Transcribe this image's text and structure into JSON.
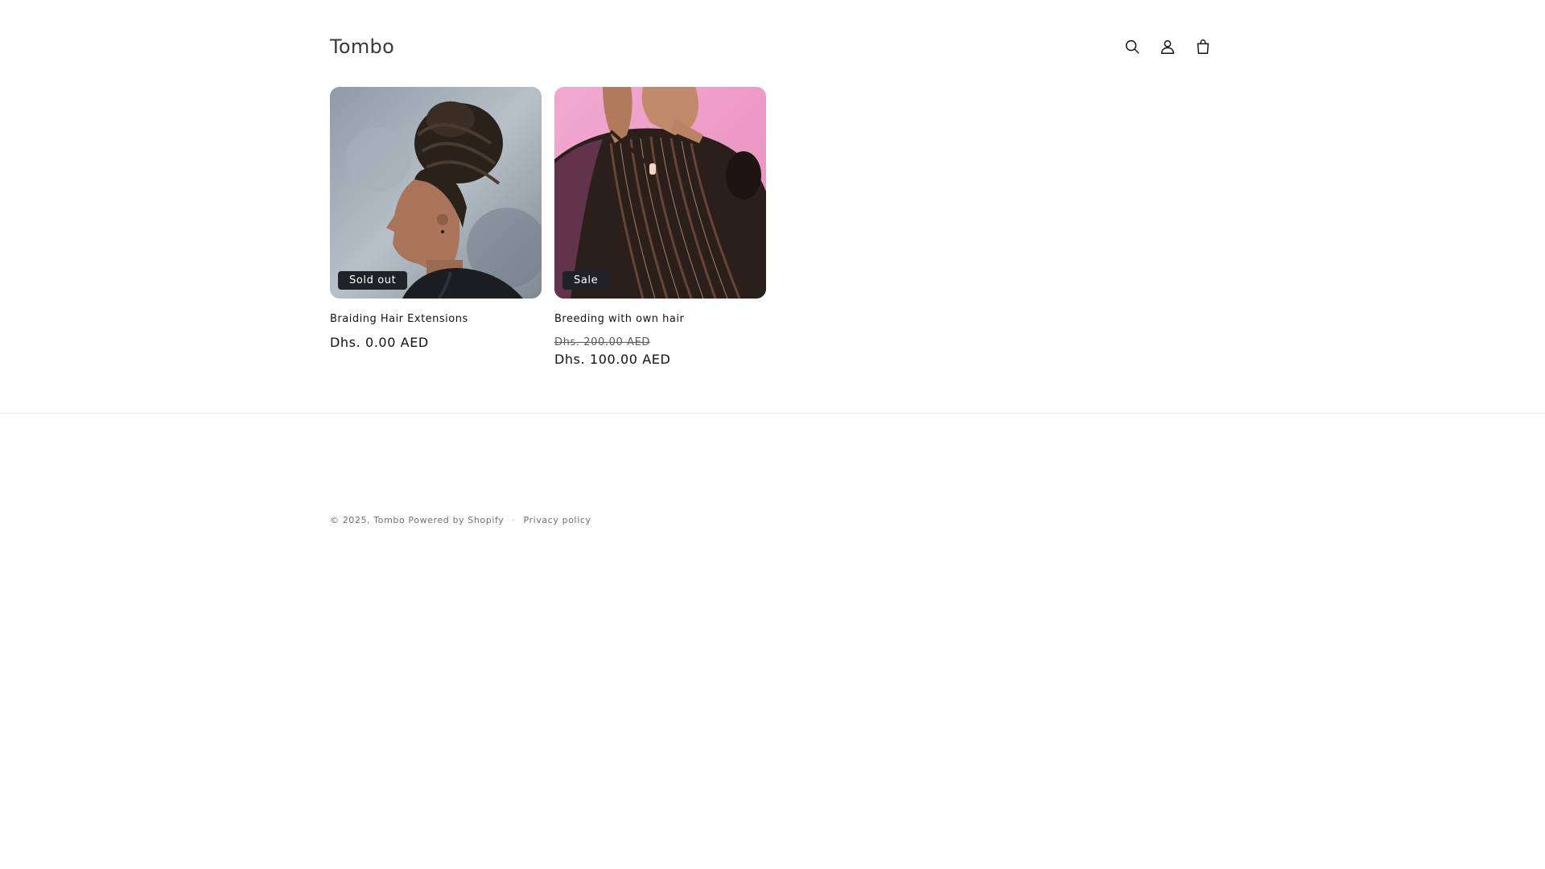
{
  "header": {
    "logo": "Tombo",
    "icons": [
      "search-icon",
      "account-icon",
      "cart-icon"
    ]
  },
  "products": [
    {
      "title": "Braiding Hair Extensions",
      "badge": "Sold out",
      "price": "Dhs. 0.00 AED"
    },
    {
      "title": "Breeding with own hair",
      "badge": "Sale",
      "compare_price": "Dhs. 200.00 AED",
      "sale_price": "Dhs. 100.00 AED"
    }
  ],
  "footer": {
    "copyright_prefix": "© 2025,",
    "store_link": "Tombo",
    "powered": "Powered by Shopify",
    "separator": "·",
    "privacy": "Privacy policy"
  },
  "colors": {
    "badge_bg": "#1f2327",
    "text": "#121212",
    "muted": "#6f6f6f"
  }
}
